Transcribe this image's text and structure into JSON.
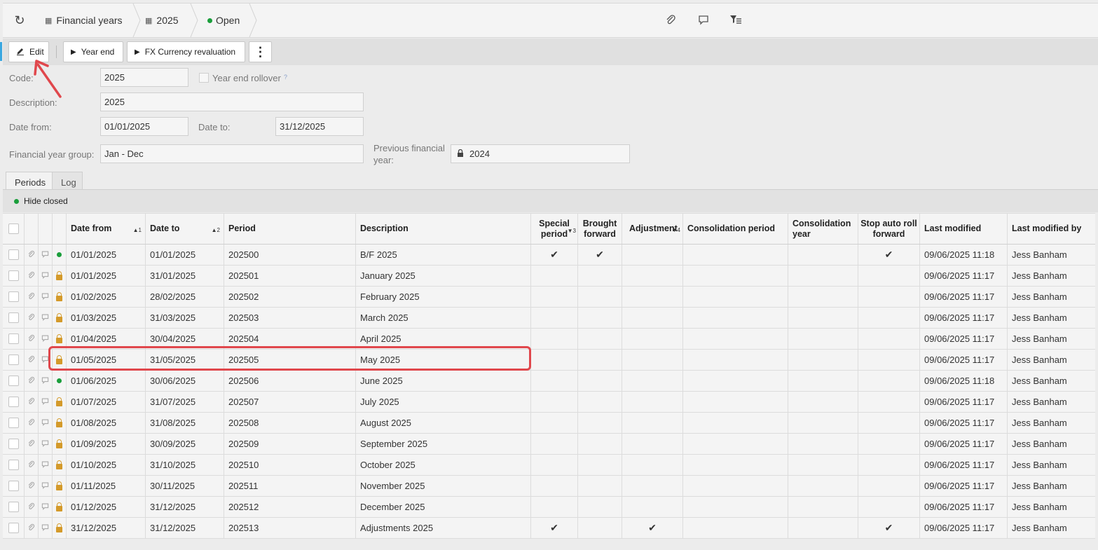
{
  "breadcrumb": {
    "items": [
      {
        "label": "Financial years",
        "icon": "calendar-icon"
      },
      {
        "label": "2025",
        "icon": "calendar-icon"
      },
      {
        "label": "Open",
        "status_color": "#1a9e3b"
      }
    ]
  },
  "header_icons": [
    "attachment-icon",
    "comment-icon",
    "filter-list-icon"
  ],
  "toolbar": {
    "edit_label": "Edit",
    "year_end_label": "Year end",
    "fx_label": "FX Currency revaluation"
  },
  "form": {
    "code_label": "Code:",
    "code_value": "2025",
    "year_end_rollover_label": "Year end rollover",
    "year_end_rollover_help": "?",
    "description_label": "Description:",
    "description_value": "2025",
    "date_from_label": "Date from:",
    "date_from_value": "01/01/2025",
    "date_to_label": "Date to:",
    "date_to_value": "31/12/2025",
    "fy_group_label": "Financial year group:",
    "fy_group_value": "Jan - Dec",
    "prev_fy_label_1": "Previous financial",
    "prev_fy_label_2": "year:",
    "prev_fy_value": "2024"
  },
  "tabs": [
    {
      "label": "Periods",
      "active": true
    },
    {
      "label": "Log",
      "active": false
    }
  ],
  "filter": {
    "label": "Hide closed"
  },
  "table": {
    "headers": {
      "date_from": "Date from",
      "date_from_sort": "▲1",
      "date_to": "Date to",
      "date_to_sort": "▲2",
      "period": "Period",
      "description": "Description",
      "special": "Special period",
      "special_sort": "▼3",
      "brought_forward": "Brought forward",
      "adjustment": "Adjustment",
      "adjustment_sort": "▼4",
      "consolidation_period": "Consolidation period",
      "consolidation_year": "Consolidation year",
      "stop_auto": "Stop auto roll forward",
      "last_modified": "Last modified",
      "last_modified_by": "Last modified by"
    },
    "rows": [
      {
        "status": "open",
        "date_from": "01/01/2025",
        "date_to": "01/01/2025",
        "period": "202500",
        "description": "B/F 2025",
        "special": true,
        "bf": true,
        "adj": false,
        "stop": true,
        "modified": "09/06/2025 11:18",
        "by": "Jess Banham"
      },
      {
        "status": "locked",
        "date_from": "01/01/2025",
        "date_to": "31/01/2025",
        "period": "202501",
        "description": "January 2025",
        "special": false,
        "bf": false,
        "adj": false,
        "stop": false,
        "modified": "09/06/2025 11:17",
        "by": "Jess Banham"
      },
      {
        "status": "locked",
        "date_from": "01/02/2025",
        "date_to": "28/02/2025",
        "period": "202502",
        "description": "February 2025",
        "special": false,
        "bf": false,
        "adj": false,
        "stop": false,
        "modified": "09/06/2025 11:17",
        "by": "Jess Banham"
      },
      {
        "status": "locked",
        "date_from": "01/03/2025",
        "date_to": "31/03/2025",
        "period": "202503",
        "description": "March 2025",
        "special": false,
        "bf": false,
        "adj": false,
        "stop": false,
        "modified": "09/06/2025 11:17",
        "by": "Jess Banham"
      },
      {
        "status": "locked",
        "date_from": "01/04/2025",
        "date_to": "30/04/2025",
        "period": "202504",
        "description": "April 2025",
        "special": false,
        "bf": false,
        "adj": false,
        "stop": false,
        "modified": "09/06/2025 11:17",
        "by": "Jess Banham"
      },
      {
        "status": "locked",
        "date_from": "01/05/2025",
        "date_to": "31/05/2025",
        "period": "202505",
        "description": "May 2025",
        "special": false,
        "bf": false,
        "adj": false,
        "stop": false,
        "modified": "09/06/2025 11:17",
        "by": "Jess Banham"
      },
      {
        "status": "open",
        "date_from": "01/06/2025",
        "date_to": "30/06/2025",
        "period": "202506",
        "description": "June 2025",
        "special": false,
        "bf": false,
        "adj": false,
        "stop": false,
        "modified": "09/06/2025 11:18",
        "by": "Jess Banham"
      },
      {
        "status": "locked",
        "date_from": "01/07/2025",
        "date_to": "31/07/2025",
        "period": "202507",
        "description": "July 2025",
        "special": false,
        "bf": false,
        "adj": false,
        "stop": false,
        "modified": "09/06/2025 11:17",
        "by": "Jess Banham"
      },
      {
        "status": "locked",
        "date_from": "01/08/2025",
        "date_to": "31/08/2025",
        "period": "202508",
        "description": "August 2025",
        "special": false,
        "bf": false,
        "adj": false,
        "stop": false,
        "modified": "09/06/2025 11:17",
        "by": "Jess Banham"
      },
      {
        "status": "locked",
        "date_from": "01/09/2025",
        "date_to": "30/09/2025",
        "period": "202509",
        "description": "September 2025",
        "special": false,
        "bf": false,
        "adj": false,
        "stop": false,
        "modified": "09/06/2025 11:17",
        "by": "Jess Banham"
      },
      {
        "status": "locked",
        "date_from": "01/10/2025",
        "date_to": "31/10/2025",
        "period": "202510",
        "description": "October 2025",
        "special": false,
        "bf": false,
        "adj": false,
        "stop": false,
        "modified": "09/06/2025 11:17",
        "by": "Jess Banham"
      },
      {
        "status": "locked",
        "date_from": "01/11/2025",
        "date_to": "30/11/2025",
        "period": "202511",
        "description": "November 2025",
        "special": false,
        "bf": false,
        "adj": false,
        "stop": false,
        "modified": "09/06/2025 11:17",
        "by": "Jess Banham"
      },
      {
        "status": "locked",
        "date_from": "01/12/2025",
        "date_to": "31/12/2025",
        "period": "202512",
        "description": "December 2025",
        "special": false,
        "bf": false,
        "adj": false,
        "stop": false,
        "modified": "09/06/2025 11:17",
        "by": "Jess Banham"
      },
      {
        "status": "locked",
        "date_from": "31/12/2025",
        "date_to": "31/12/2025",
        "period": "202513",
        "description": "Adjustments 2025",
        "special": true,
        "bf": false,
        "adj": true,
        "stop": true,
        "modified": "09/06/2025 11:17",
        "by": "Jess Banham"
      }
    ]
  },
  "annotations": {
    "highlight_color": "#e0474c"
  }
}
